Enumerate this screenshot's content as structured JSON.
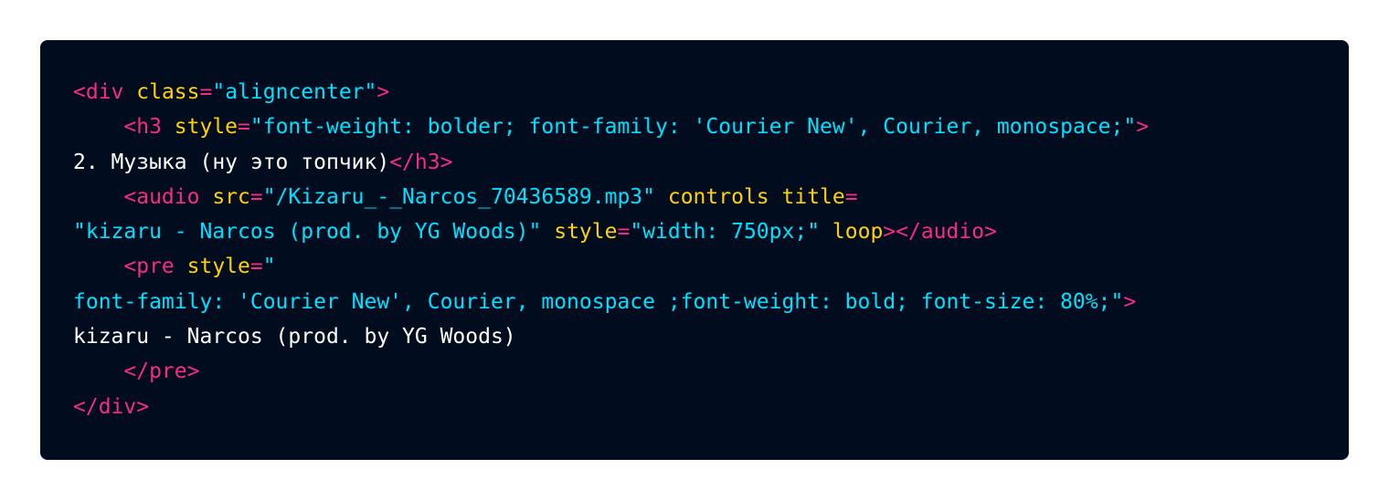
{
  "code": {
    "lines": [
      [
        {
          "t": "<div ",
          "k": "tag"
        },
        {
          "t": "class",
          "k": "attr"
        },
        {
          "t": "=",
          "k": "tag"
        },
        {
          "t": "\"aligncenter\"",
          "k": "val"
        },
        {
          "t": ">",
          "k": "tag"
        }
      ],
      [
        {
          "t": "    <h3 ",
          "k": "tag"
        },
        {
          "t": "style",
          "k": "attr"
        },
        {
          "t": "=",
          "k": "tag"
        },
        {
          "t": "\"font-weight: bolder; font-family: 'Courier New', Courier, monospace;\"",
          "k": "val"
        },
        {
          "t": ">",
          "k": "tag"
        }
      ],
      [
        {
          "t": "2. Музыка (ну это топчик)",
          "k": "txt"
        },
        {
          "t": "</h3>",
          "k": "tag"
        }
      ],
      [
        {
          "t": "    <audio ",
          "k": "tag"
        },
        {
          "t": "src",
          "k": "attr"
        },
        {
          "t": "=",
          "k": "tag"
        },
        {
          "t": "\"/Kizaru_-_Narcos_70436589.mp3\"",
          "k": "val"
        },
        {
          "t": " ",
          "k": "txt"
        },
        {
          "t": "controls",
          "k": "attr"
        },
        {
          "t": " ",
          "k": "txt"
        },
        {
          "t": "title",
          "k": "attr"
        },
        {
          "t": "=",
          "k": "tag"
        }
      ],
      [
        {
          "t": "\"kizaru - Narcos (prod. by YG Woods)\"",
          "k": "val"
        },
        {
          "t": " ",
          "k": "txt"
        },
        {
          "t": "style",
          "k": "attr"
        },
        {
          "t": "=",
          "k": "tag"
        },
        {
          "t": "\"width: 750px;\"",
          "k": "val"
        },
        {
          "t": " ",
          "k": "txt"
        },
        {
          "t": "loop",
          "k": "attr"
        },
        {
          "t": "></audio>",
          "k": "tag"
        }
      ],
      [
        {
          "t": "    <pre ",
          "k": "tag"
        },
        {
          "t": "style",
          "k": "attr"
        },
        {
          "t": "=",
          "k": "tag"
        },
        {
          "t": "\"",
          "k": "val"
        }
      ],
      [
        {
          "t": "font-family: 'Courier New', Courier, monospace ;font-weight: bold; font-size: 80%;\"",
          "k": "val"
        },
        {
          "t": ">",
          "k": "tag"
        }
      ],
      [
        {
          "t": "kizaru - Narcos (prod. by YG Woods)",
          "k": "txt"
        }
      ],
      [
        {
          "t": "    </pre>",
          "k": "tag"
        }
      ],
      [
        {
          "t": "</div>",
          "k": "tag"
        }
      ]
    ]
  },
  "colors": {
    "background": "#010c1f",
    "tag": "#f92a82",
    "attribute": "#ffd100",
    "value": "#00e1ff",
    "text": "#ffffff"
  }
}
